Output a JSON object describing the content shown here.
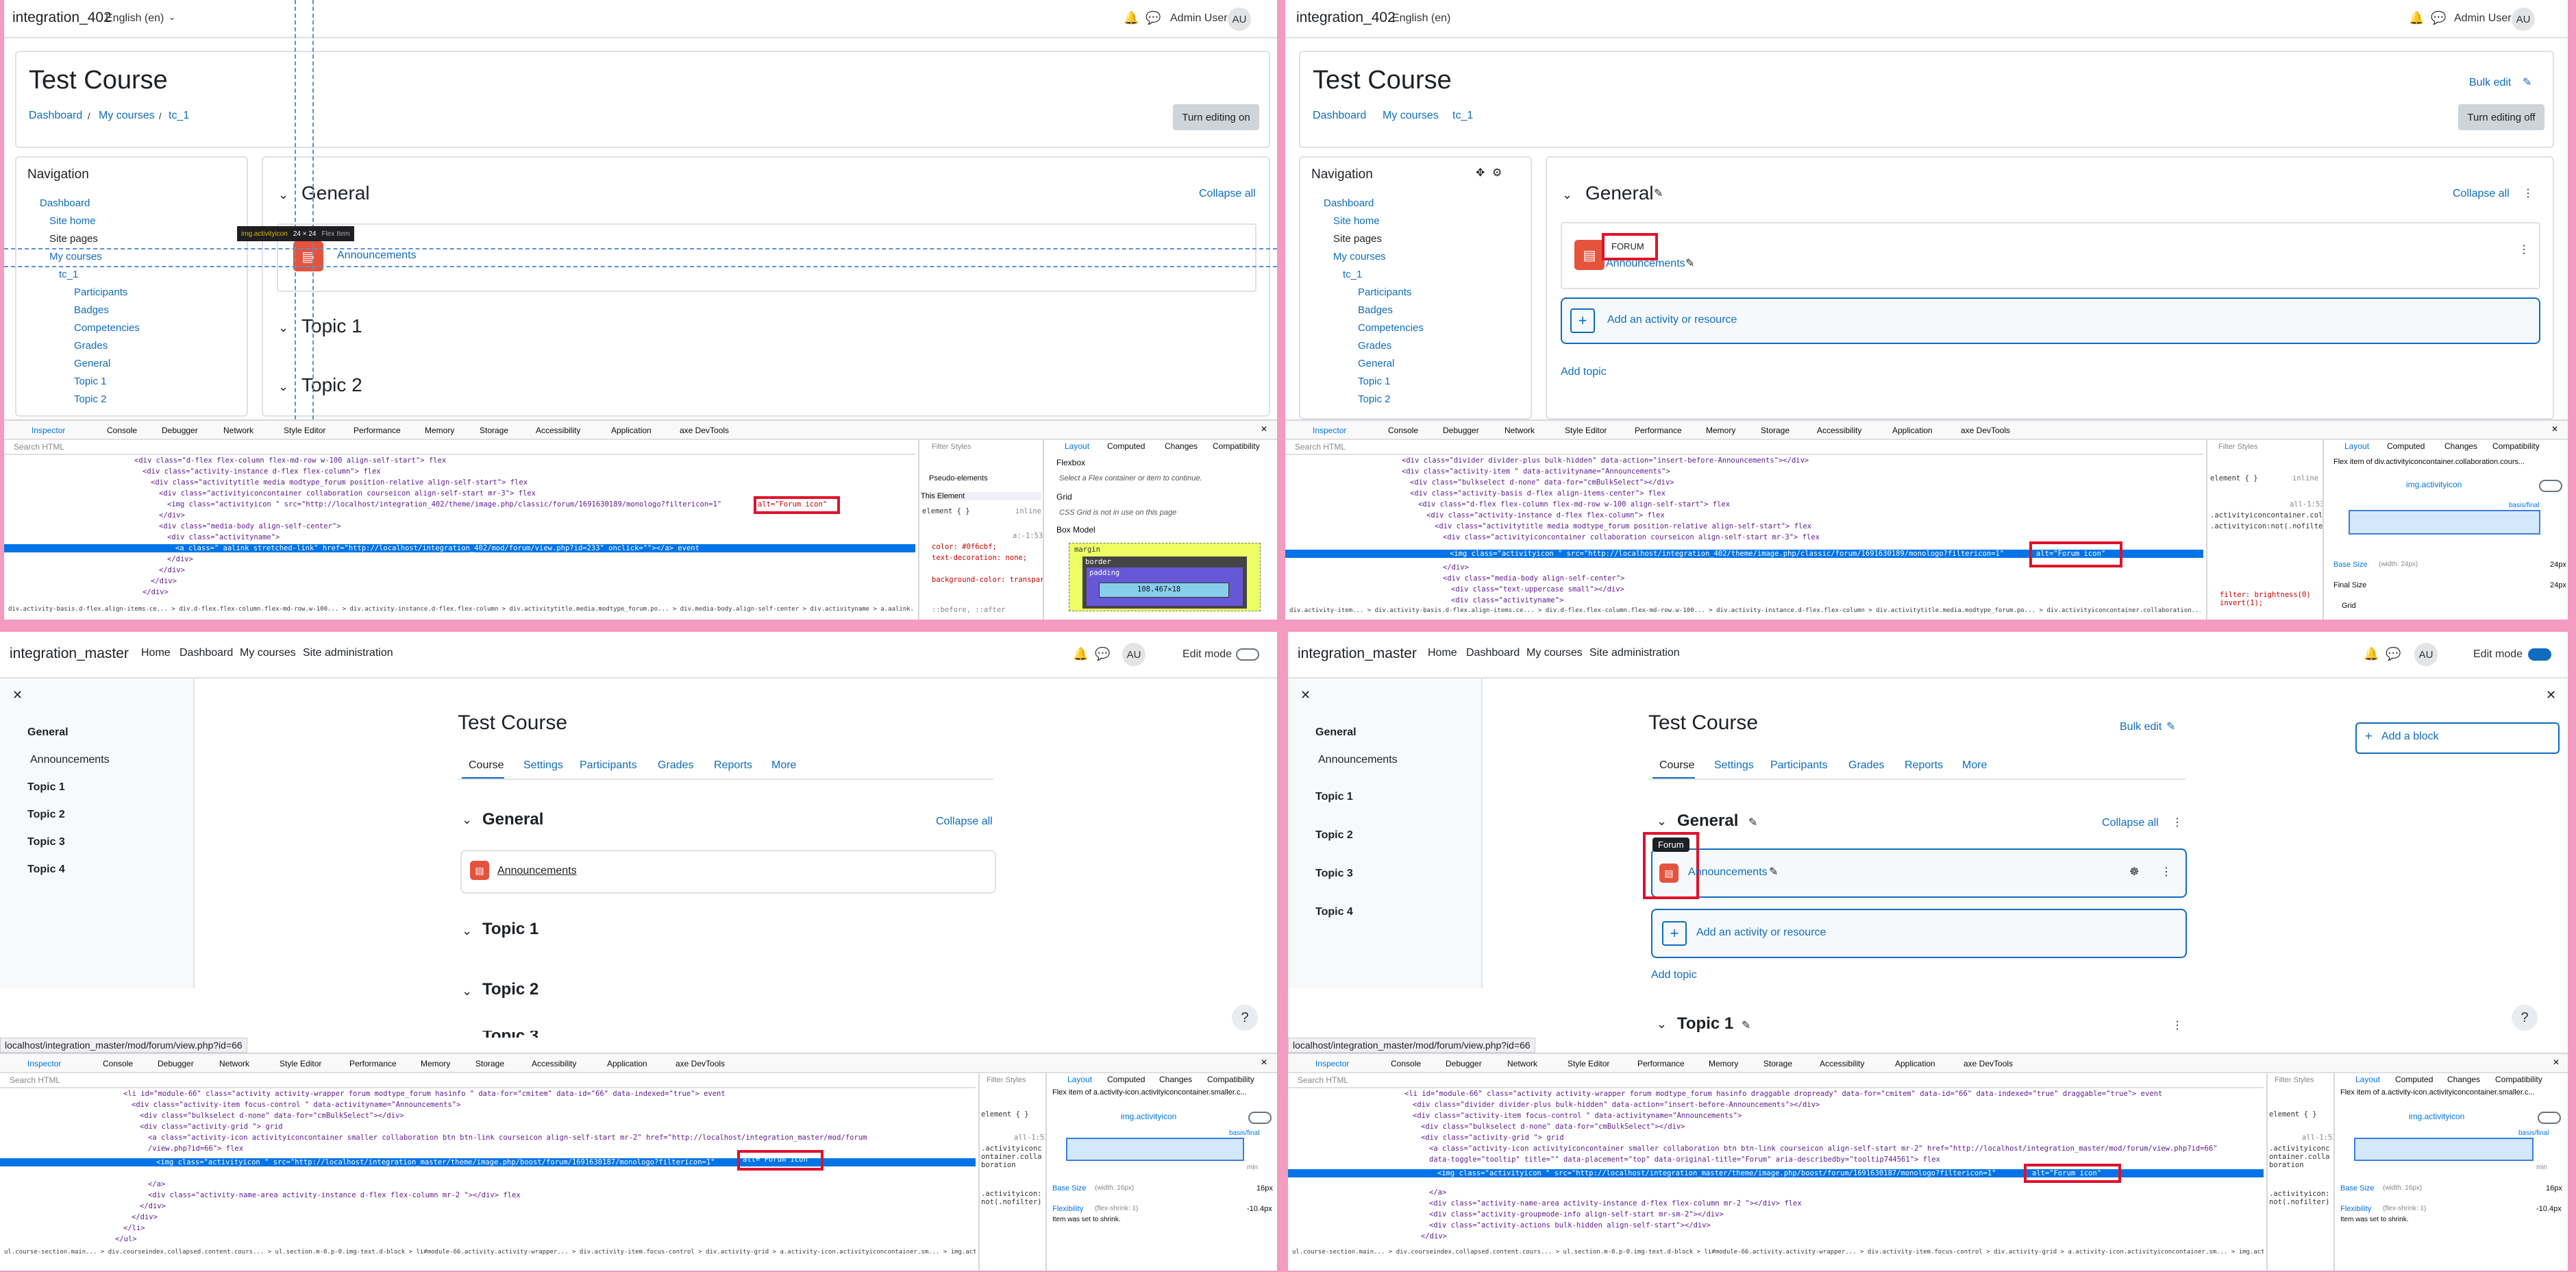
{
  "common": {
    "lang": "English (en)",
    "admin_user": "Admin User",
    "avatar": "AU",
    "course_title": "Test Course",
    "crumbs": [
      "Dashboard",
      "My courses",
      "tc_1"
    ],
    "collapse_all": "Collapse all",
    "general": "General",
    "announcements": "Announcements",
    "topic1": "Topic 1",
    "topic2": "Topic 2",
    "topic3": "Topic 3",
    "topic4": "Topic 4",
    "add_activity": "Add an activity or resource",
    "add_topic": "Add topic",
    "bulk_edit": "Bulk edit",
    "forum_upper": "FORUM",
    "forum_tip": "Forum",
    "edit_mode": "Edit mode",
    "status_url": "localhost/integration_master/mod/forum/view.php?id=66"
  },
  "site_names": {
    "q1": "integration_402",
    "q2": "integration_402",
    "q3": "integration_master",
    "q4": "integration_master"
  },
  "buttons": {
    "turn_on": "Turn editing on",
    "turn_off": "Turn editing off"
  },
  "nav_block": {
    "title": "Navigation",
    "items": [
      "Dashboard",
      "Site home",
      "Site pages",
      "My courses",
      "tc_1",
      "Participants",
      "Badges",
      "Competencies",
      "Grades",
      "General",
      "Topic 1",
      "Topic 2"
    ]
  },
  "moodle_nav": [
    "Home",
    "Dashboard",
    "My courses",
    "Site administration"
  ],
  "course_tabs": [
    "Course",
    "Settings",
    "Participants",
    "Grades",
    "Reports",
    "More"
  ],
  "devtools": {
    "tabs": [
      "Inspector",
      "Console",
      "Debugger",
      "Network",
      "Style Editor",
      "Performance",
      "Memory",
      "Storage",
      "Accessibility",
      "Application",
      "axe DevTools"
    ],
    "search_html": "Search HTML",
    "filter_styles": "Filter Styles",
    "layout_tabs": [
      "Layout",
      "Computed",
      "Changes",
      "Compatibility"
    ],
    "alt_attr": "alt=\"Forum icon\"",
    "this_element": "This Element",
    "pseudo": "Pseudo-elements",
    "flexbox": "Flexbox",
    "flex_msg": "Select a Flex container or item to continue.",
    "grid": "Grid",
    "grid_msg": "CSS Grid is not in use on this page",
    "box_model": "Box Model",
    "margin": "margin",
    "border": "border",
    "padding": "padding",
    "box_dims": "108.467×18",
    "img_selector": "img.activityicon",
    "flex_item_of": "Flex item of div.activityiconcontainer.collaboration.cours...",
    "flex_item_of2": "Flex item of a.activity-icon.activityiconcontainer.smaller.c...",
    "base_size": "Base Size",
    "base_size_val_24": "(width: 24px)",
    "base_size_val_16": "(width: 16px)",
    "final_size": "Final Size",
    "px24": "24px",
    "px16": "16px",
    "flexibility": "Flexibility",
    "flex_shrink": "(flex-shrink: 1)",
    "item_shrink": "Item was set to shrink.",
    "neg": "-10.4px",
    "grid_label": "Grid",
    "basis_final": "basis/final",
    "min": "min"
  },
  "tooltip": {
    "name": "img.activityicon",
    "size": "24 × 24",
    "type": "Flex Item"
  },
  "q1_code": [
    "<div class=\"d-flex flex-column flex-md-row w-100 align-self-start\"> flex",
    "<div class=\"activity-instance d-flex flex-column\"> flex",
    "<div class=\"activitytitle media modtype_forum position-relative align-self-start\"> flex",
    "<div class=\"activityiconcontainer collaboration courseicon align-self-start mr-3\"> flex",
    "<img class=\"activityicon \" src=\"http://localhost/integration_402/theme/image.php/classic/forum/1691630189/monologo?filtericon=1\"",
    "</div>",
    "<div class=\"media-body align-self-center\">",
    "<div class=\"activityname\">",
    "<a class=\" aalink stretched-link\" href=\"http://localhost/integration_402/mod/forum/view.php?id=233\" onclick=\"\"></a> event",
    "</div>",
    "</div>",
    "</div>",
    "</div>"
  ],
  "q2_code": [
    "<div class=\"divider divider-plus bulk-hidden\" data-action=\"insert-before-Announcements\"></div>",
    "<div class=\"activity-item \" data-activityname=\"Announcements\">",
    "<div class=\"bulkselect d-none\" data-for=\"cmBulkSelect\"></div>",
    "<div class=\"activity-basis d-flex align-items-center\"> flex",
    "<div class=\"d-flex flex-column flex-md-row w-100 align-self-start\"> flex",
    "<div class=\"activity-instance d-flex flex-column\"> flex",
    "<div class=\"activitytitle media modtype_forum position-relative align-self-start\"> flex",
    "<div class=\"activityiconcontainer collaboration courseicon align-self-start mr-3\"> flex",
    "<img class=\"activityicon \" src=\"http://localhost/integration_402/theme/image.php/classic/forum/1691630189/monologo?filtericon=1\"",
    "</div>",
    "<div class=\"media-body align-self-center\">",
    "<div class=\"text-uppercase small\"></div>",
    "<div class=\"activityname\">"
  ],
  "q3_code": [
    "<li id=\"module-66\" class=\"activity activity-wrapper forum modtype_forum hasinfo \" data-for=\"cmitem\" data-id=\"66\" data-indexed=\"true\"> event",
    "<div class=\"activity-item focus-control \" data-activityname=\"Announcements\">",
    "<div class=\"bulkselect d-none\" data-for=\"cmBulkSelect\"></div>",
    "<div class=\"activity-grid \"> grid",
    "<a class=\"activity-icon activityiconcontainer smaller collaboration btn btn-link courseicon align-self-start mr-2\" href=\"http://localhost/integration_master/mod/forum",
    "/view.php?id=66\"> flex",
    "<img class=\"activityicon \" src=\"http://localhost/integration_master/theme/image.php/boost/forum/1691630187/monologo?filtericon=1\"",
    "</a>",
    "<div class=\"activity-name-area activity-instance d-flex flex-column mr-2 \"></div> flex",
    "</div>",
    "</div>",
    "</li>",
    "</ul>"
  ],
  "q4_code": [
    "<li id=\"module-66\" class=\"activity activity-wrapper forum modtype_forum hasinfo draggable dropready\" data-for=\"cmitem\" data-id=\"66\" data-indexed=\"true\" draggable=\"true\"> event",
    "<div class=\"divider divider-plus bulk-hidden\" data-action=\"insert-before-Announcements\"></div>",
    "<div class=\"activity-item focus-control \" data-activityname=\"Announcements\">",
    "<div class=\"bulkselect d-none\" data-for=\"cmBulkSelect\"></div>",
    "<div class=\"activity-grid \"> grid",
    "<a class=\"activity-icon activityiconcontainer smaller collaboration btn btn-link courseicon align-self-start mr-2\" href=\"http://localhost/integration_master/mod/forum/view.php?id=66\"",
    "data-toggle=\"tooltip\" title=\"\" data-placement=\"top\" data-original-title=\"Forum\" aria-describedby=\"tooltip744561\"> flex",
    "<img class=\"activityicon \" src=\"http://localhost/integration_master/theme/image.php/boost/forum/1691630187/monologo?filtericon=1\"",
    "</a>",
    "<div class=\"activity-name-area activity-instance d-flex flex-column mr-2 \"></div> flex",
    "<div class=\"activity-groupmode-info align-self-start mr-sm-2\"></div>",
    "<div class=\"activity-actions bulk-hidden align-self-start\"></div>",
    "</div>"
  ],
  "crumbs_bar": {
    "q1": "div.activity-basis.d-flex.align-items.ce... > div.d-flex.flex-column.flex-md-row.w-100... > div.activity-instance.d-flex.flex-column > div.activitytitle.media.modtype_forum.po... > div.media-body.align-self-center > div.activityname > a.aalink.stretched-link",
    "q2": "div.activity-item... > div.activity-basis.d-flex.align-items.ce... > div.d-flex.flex-column.flex-md-row.w-100... > div.activity-instance.d-flex.flex-column > div.activitytitle.media.modtype_forum.po... > div.activityiconcontainer.collaboration... > img.activityicon",
    "q3": "ul.course-section.main... > div.courseindex.collapsed.content.cours... > ul.section.m-0.p-0.img-text.d-block > li#module-66.activity.activity-wrapper... > div.activity-item.focus-control > div.activity-grid > a.activity-icon.activityiconcontainer.sm... > img.activityicon",
    "q4": "ul.course-section.main... > div.courseindex.collapsed.content.cours... > ul.section.m-0.p-0.img-text.d-block > li#module-66.activity.activity-wrapper... > div.activity-item.focus-control > div.activity-grid > a.activity-icon.activityiconcontainer.sm... > img.activityicon"
  },
  "rules": {
    "q1": [
      "element { }",
      "inline",
      "a:-1:53",
      "color: #0f6cbf;",
      "text-decoration: none;",
      "background-color: transparent;",
      "::before, ::after"
    ],
    "q2": [
      "element { }",
      "inline",
      "all-1:53",
      ".activityiconcontainer.collaboration",
      ".activityicon:not(.nofilter)",
      "filter: brightness(0) invert(1);"
    ],
    "q3": [
      "element { }",
      "all-1:53",
      ".activityiconcontainer.collaboration",
      ".activityicon:not(.nofilter)"
    ],
    "q4": [
      "element { }",
      "all-1:53",
      ".activityiconcontainer.collaboration",
      ".activityicon:not(.nofilter)"
    ]
  }
}
